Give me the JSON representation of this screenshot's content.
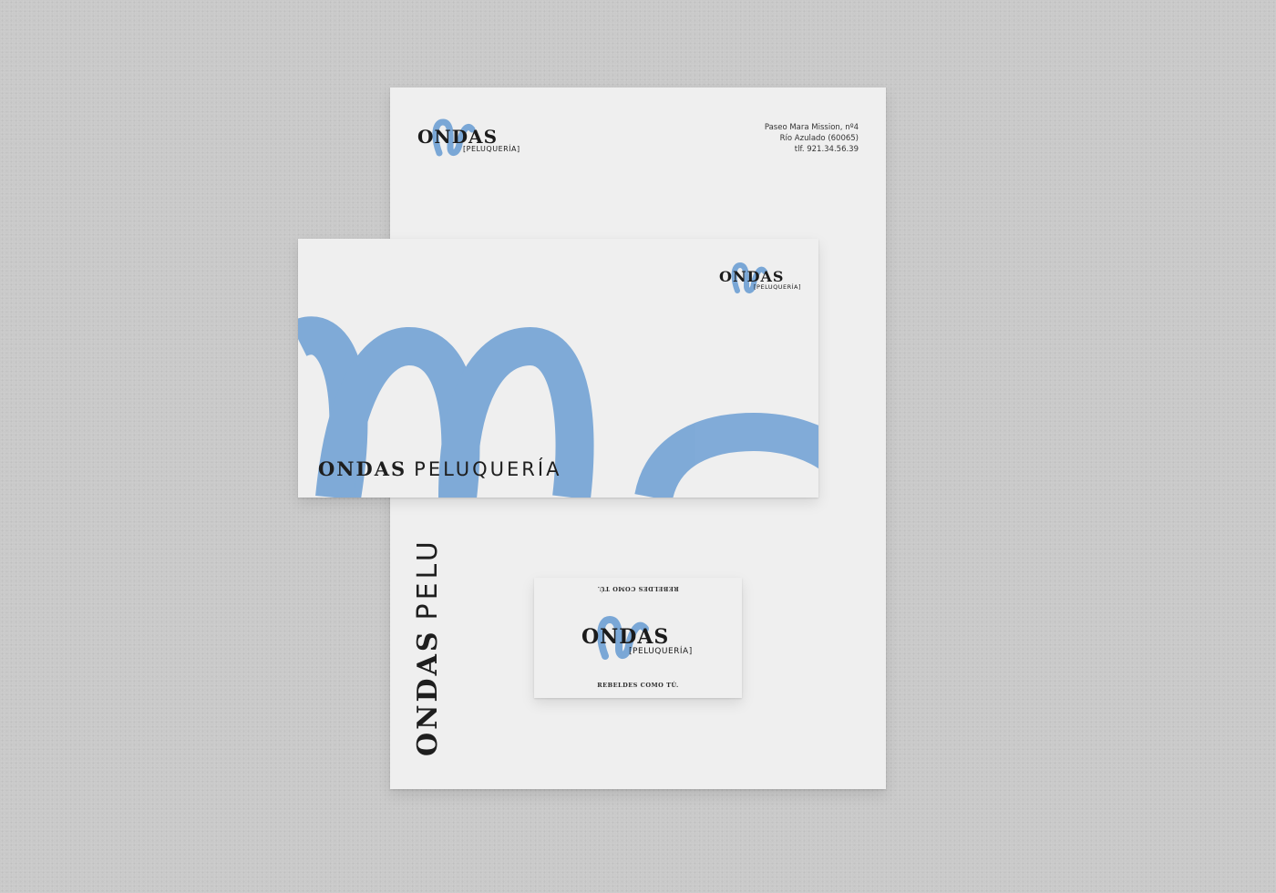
{
  "brand": {
    "name": "ONDAS",
    "sub_bracket": "[PELUQUERÍA]",
    "sub_plain": "PELUQUERÍA",
    "vertical_sub": "PELU",
    "accent_color": "#7aa7d6"
  },
  "letterhead": {
    "address_line1": "Paseo Mara Mission, nº4",
    "address_line2": "Río Azulado (60065)",
    "address_line3": "tlf. 921.34.56.39"
  },
  "business_card": {
    "tagline": "REBELDES COMO TÚ."
  },
  "colors": {
    "background": "#c9c9c9",
    "paper": "#efefef",
    "accent": "#7aa7d6",
    "ink": "#1e1e1e"
  }
}
